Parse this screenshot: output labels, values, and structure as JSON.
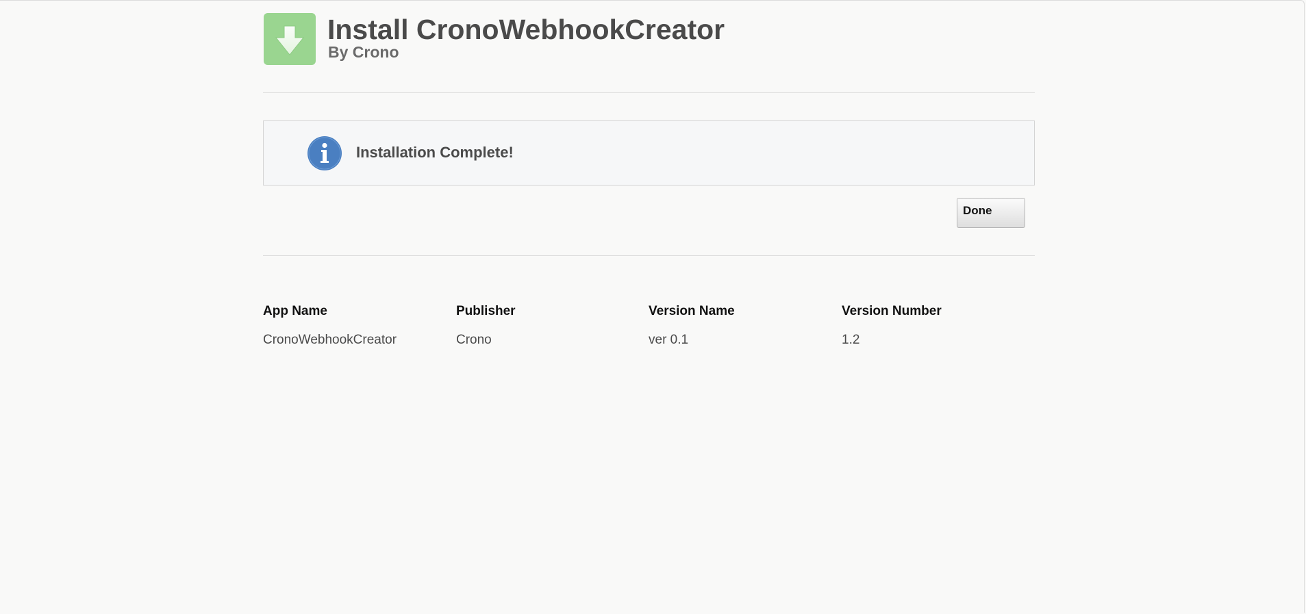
{
  "header": {
    "title": "Install CronoWebhookCreator",
    "subtitle": "By Crono",
    "icon": "download-arrow-icon",
    "icon_color": "#9ad590"
  },
  "message": {
    "icon": "info-icon",
    "icon_color": "#4a7fc1",
    "text": "Installation Complete!"
  },
  "actions": {
    "done_label": "Done"
  },
  "details": {
    "columns": [
      {
        "header": "App Name",
        "value": "CronoWebhookCreator"
      },
      {
        "header": "Publisher",
        "value": "Crono"
      },
      {
        "header": "Version Name",
        "value": "ver 0.1"
      },
      {
        "header": "Version Number",
        "value": "1.2"
      }
    ]
  }
}
